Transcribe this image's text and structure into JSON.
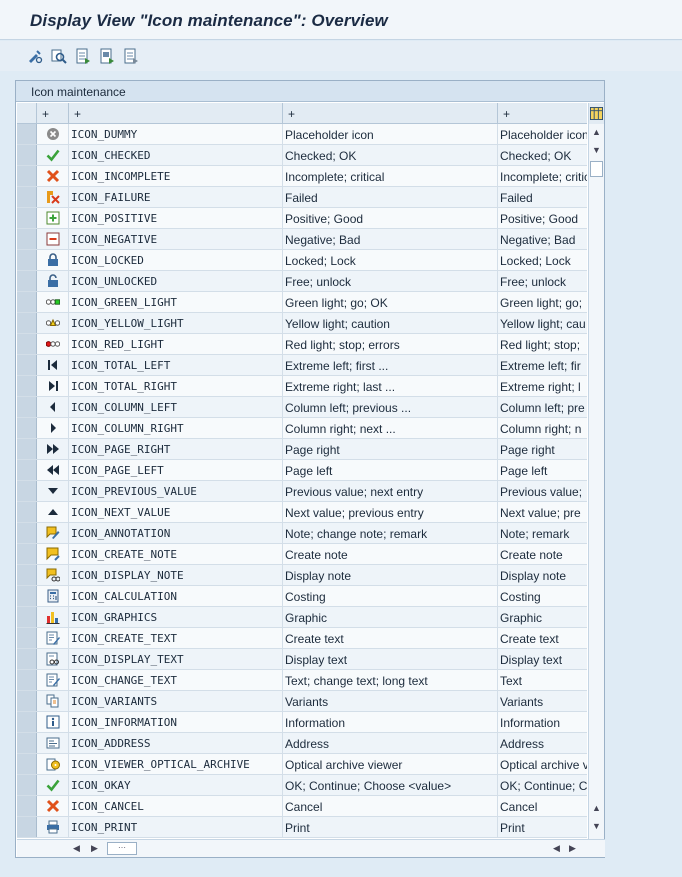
{
  "window": {
    "title": "Display View \"Icon maintenance\": Overview"
  },
  "toolbar": {
    "buttons": [
      {
        "name": "change-display-icon"
      },
      {
        "name": "find-icon"
      },
      {
        "name": "select-all-icon"
      },
      {
        "name": "select-block-icon"
      },
      {
        "name": "deselect-all-icon"
      }
    ]
  },
  "panel": {
    "title": "Icon maintenance",
    "columns": [
      "+",
      "+",
      "+"
    ],
    "rows": [
      {
        "icon": "dummy-icon",
        "name": "ICON_DUMMY",
        "desc": "Placeholder icon",
        "short": "Placeholder icon"
      },
      {
        "icon": "checked-icon",
        "name": "ICON_CHECKED",
        "desc": "Checked; OK",
        "short": "Checked; OK"
      },
      {
        "icon": "incomplete-icon",
        "name": "ICON_INCOMPLETE",
        "desc": "Incomplete; critical",
        "short": "Incomplete; critical"
      },
      {
        "icon": "failure-icon",
        "name": "ICON_FAILURE",
        "desc": "Failed",
        "short": "Failed"
      },
      {
        "icon": "positive-icon",
        "name": "ICON_POSITIVE",
        "desc": "Positive; Good",
        "short": "Positive; Good"
      },
      {
        "icon": "negative-icon",
        "name": "ICON_NEGATIVE",
        "desc": "Negative; Bad",
        "short": "Negative; Bad"
      },
      {
        "icon": "locked-icon",
        "name": "ICON_LOCKED",
        "desc": "Locked; Lock",
        "short": "Locked; Lock"
      },
      {
        "icon": "unlocked-icon",
        "name": "ICON_UNLOCKED",
        "desc": "Free; unlock",
        "short": "Free; unlock"
      },
      {
        "icon": "green-light-icon",
        "name": "ICON_GREEN_LIGHT",
        "desc": "Green light; go; OK",
        "short": "Green light; go;"
      },
      {
        "icon": "yellow-light-icon",
        "name": "ICON_YELLOW_LIGHT",
        "desc": "Yellow light; caution",
        "short": "Yellow light; cau"
      },
      {
        "icon": "red-light-icon",
        "name": "ICON_RED_LIGHT",
        "desc": "Red light; stop; errors",
        "short": "Red light; stop;"
      },
      {
        "icon": "total-left-icon",
        "name": "ICON_TOTAL_LEFT",
        "desc": "Extreme left; first ...",
        "short": "Extreme left; fir"
      },
      {
        "icon": "total-right-icon",
        "name": "ICON_TOTAL_RIGHT",
        "desc": "Extreme right; last ...",
        "short": "Extreme right; l"
      },
      {
        "icon": "column-left-icon",
        "name": "ICON_COLUMN_LEFT",
        "desc": "Column left; previous ...",
        "short": "Column left; pre"
      },
      {
        "icon": "column-right-icon",
        "name": "ICON_COLUMN_RIGHT",
        "desc": "Column right; next ...",
        "short": "Column right; n"
      },
      {
        "icon": "page-right-icon",
        "name": "ICON_PAGE_RIGHT",
        "desc": "Page right",
        "short": "Page right"
      },
      {
        "icon": "page-left-icon",
        "name": "ICON_PAGE_LEFT",
        "desc": "Page left",
        "short": "Page left"
      },
      {
        "icon": "previous-value-icon",
        "name": "ICON_PREVIOUS_VALUE",
        "desc": "Previous value; next entry",
        "short": "Previous value;"
      },
      {
        "icon": "next-value-icon",
        "name": "ICON_NEXT_VALUE",
        "desc": "Next value; previous entry",
        "short": "Next value; pre"
      },
      {
        "icon": "annotation-icon",
        "name": "ICON_ANNOTATION",
        "desc": "Note; change note; remark",
        "short": "Note; remark"
      },
      {
        "icon": "create-note-icon",
        "name": "ICON_CREATE_NOTE",
        "desc": "Create note",
        "short": "Create note"
      },
      {
        "icon": "display-note-icon",
        "name": "ICON_DISPLAY_NOTE",
        "desc": "Display note",
        "short": "Display note"
      },
      {
        "icon": "calculation-icon",
        "name": "ICON_CALCULATION",
        "desc": "Costing",
        "short": "Costing"
      },
      {
        "icon": "graphics-icon",
        "name": "ICON_GRAPHICS",
        "desc": "Graphic",
        "short": "Graphic"
      },
      {
        "icon": "create-text-icon",
        "name": "ICON_CREATE_TEXT",
        "desc": "Create text",
        "short": "Create text"
      },
      {
        "icon": "display-text-icon",
        "name": "ICON_DISPLAY_TEXT",
        "desc": "Display text",
        "short": "Display text"
      },
      {
        "icon": "change-text-icon",
        "name": "ICON_CHANGE_TEXT",
        "desc": "Text; change text; long text",
        "short": "Text"
      },
      {
        "icon": "variants-icon",
        "name": "ICON_VARIANTS",
        "desc": "Variants",
        "short": "Variants"
      },
      {
        "icon": "information-icon",
        "name": "ICON_INFORMATION",
        "desc": "Information",
        "short": "Information"
      },
      {
        "icon": "address-icon",
        "name": "ICON_ADDRESS",
        "desc": "Address",
        "short": "Address"
      },
      {
        "icon": "optical-archive-icon",
        "name": "ICON_VIEWER_OPTICAL_ARCHIVE",
        "desc": "Optical archive viewer",
        "short": "Optical archive v"
      },
      {
        "icon": "okay-icon",
        "name": "ICON_OKAY",
        "desc": "OK; Continue; Choose <value>",
        "short": "OK; Continue; C"
      },
      {
        "icon": "cancel-icon",
        "name": "ICON_CANCEL",
        "desc": "Cancel",
        "short": "Cancel"
      },
      {
        "icon": "print-icon",
        "name": "ICON_PRINT",
        "desc": "Print",
        "short": "Print"
      }
    ]
  },
  "colors": {
    "title_text": "#1b2b44",
    "header_bg": "#d5e3f0",
    "selector_bg": "#c8d6e3"
  }
}
